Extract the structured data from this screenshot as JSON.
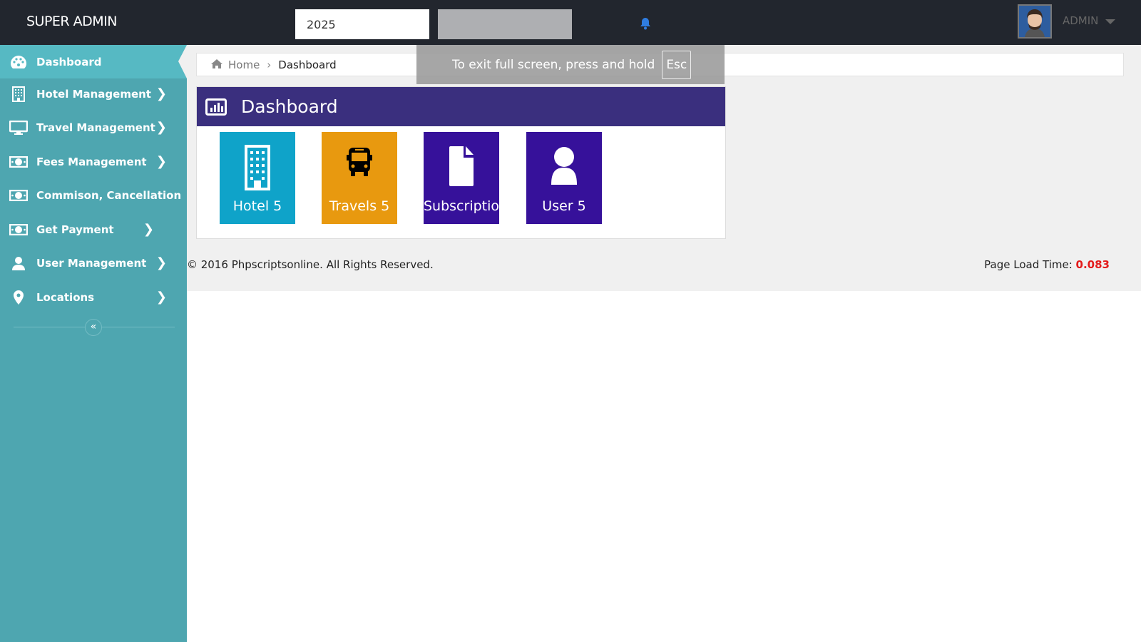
{
  "header": {
    "brand": "SUPER ADMIN",
    "year_value": "2025",
    "user_name": "ADMIN"
  },
  "sidebar": {
    "items": [
      {
        "label": "Dashboard",
        "icon": "dashboard-icon",
        "active": true,
        "has_children": false
      },
      {
        "label": "Hotel Management",
        "icon": "building-icon",
        "has_children": true
      },
      {
        "label": "Travel Management",
        "icon": "monitor-icon",
        "has_children": true
      },
      {
        "label": "Fees Management",
        "icon": "money-icon",
        "has_children": true
      },
      {
        "label": "Commison, Cancellation",
        "icon": "money-icon",
        "has_children": false
      },
      {
        "label": "Get Payment",
        "icon": "money-icon",
        "has_children": true
      },
      {
        "label": "User Management",
        "icon": "user-icon",
        "has_children": true
      },
      {
        "label": "Locations",
        "icon": "map-marker-icon",
        "has_children": true
      }
    ],
    "collapse_label": "«"
  },
  "breadcrumb": {
    "home": "Home",
    "current": "Dashboard"
  },
  "fullscreen_notice": {
    "text": "To exit full screen, press and hold",
    "key": "Esc"
  },
  "panel": {
    "title": "Dashboard",
    "tiles": [
      {
        "label": "Hotel 5",
        "icon": "building-icon",
        "color": "#0fa3c9"
      },
      {
        "label": "Travels 5",
        "icon": "bus-icon",
        "color": "#e8990f"
      },
      {
        "label": "Subscriptio",
        "icon": "file-icon",
        "color": "#36119a"
      },
      {
        "label": "User 5",
        "icon": "user-icon",
        "color": "#36119a"
      }
    ]
  },
  "footer": {
    "copyright": "© 2016 Phpscriptsonline. All Rights Reserved.",
    "load_label": "Page Load Time:",
    "load_value": "0.083"
  },
  "colors": {
    "topbar": "#22262e",
    "sidebar": "#4ea6b0",
    "panel_header": "#3a2f7e",
    "load_time": "#e31b1b"
  }
}
